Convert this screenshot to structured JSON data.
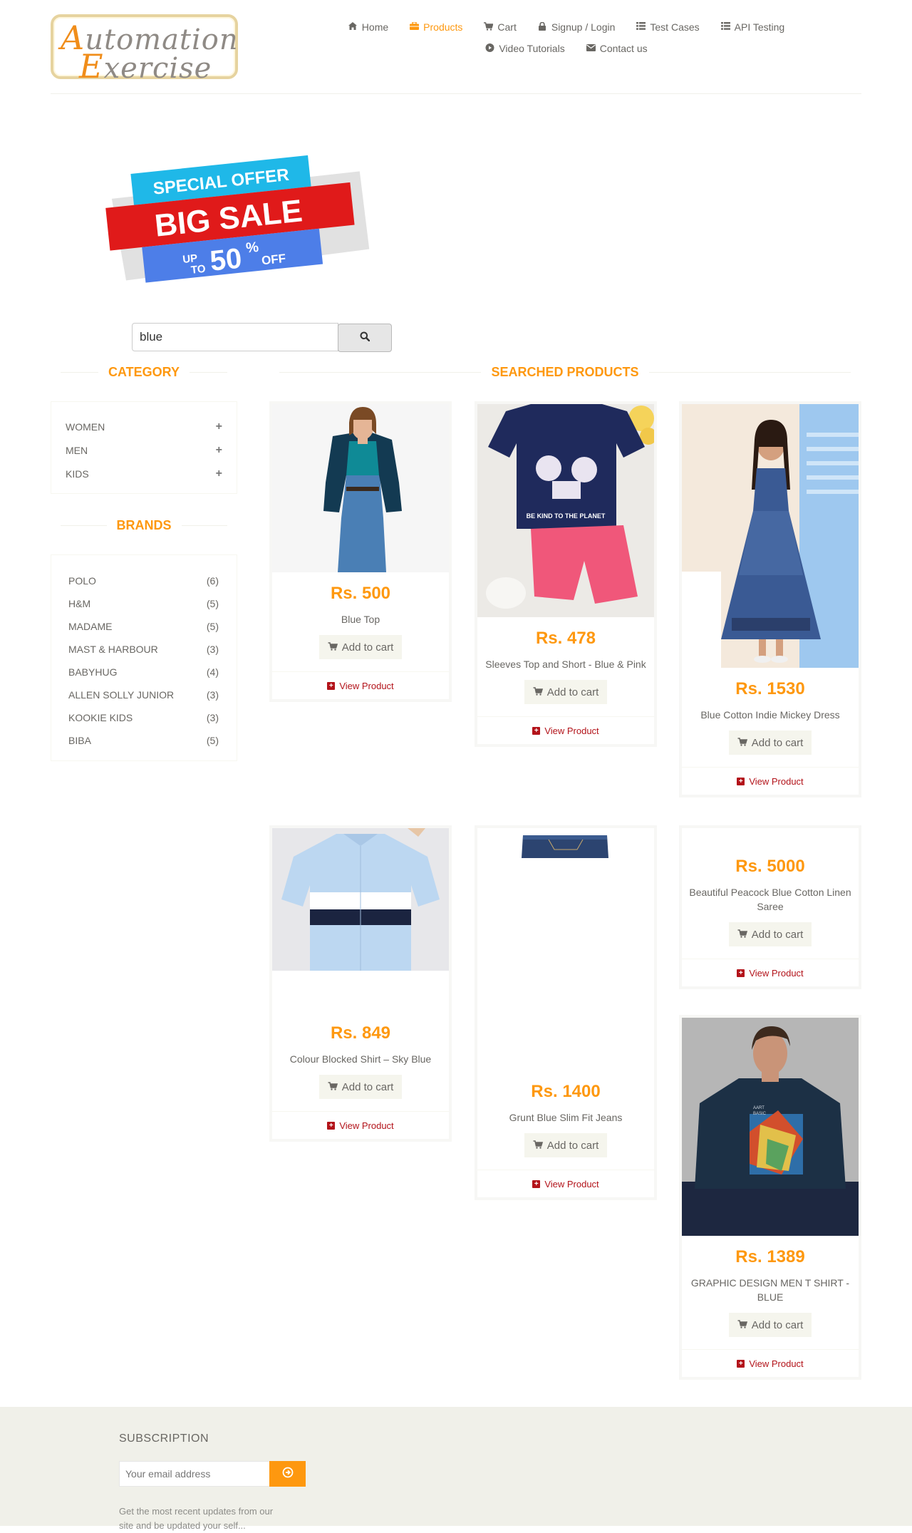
{
  "logo": {
    "line1_cap": "A",
    "line1_rest": "utomation",
    "line2_cap": "E",
    "line2_rest": "xercise"
  },
  "nav": [
    {
      "label": "Home",
      "icon": "home-icon",
      "active": false
    },
    {
      "label": "Products",
      "icon": "briefcase-icon",
      "active": true
    },
    {
      "label": "Cart",
      "icon": "cart-icon",
      "active": false
    },
    {
      "label": "Signup / Login",
      "icon": "lock-icon",
      "active": false
    },
    {
      "label": "Test Cases",
      "icon": "list-icon",
      "active": false
    },
    {
      "label": "API Testing",
      "icon": "list-icon",
      "active": false
    },
    {
      "label": "Video Tutorials",
      "icon": "youtube-play-icon",
      "active": false
    },
    {
      "label": "Contact us",
      "icon": "envelope-icon",
      "active": false
    }
  ],
  "banner": {
    "line1": "SPECIAL OFFER",
    "line2": "BIG SALE",
    "line3a": "UP",
    "line3b": "TO",
    "line3c": "50",
    "line3d": "%",
    "line3e": "OFF"
  },
  "search": {
    "value": "blue"
  },
  "sidebar": {
    "category_title": "CATEGORY",
    "categories": [
      "WOMEN",
      "MEN",
      "KIDS"
    ],
    "brands_title": "BRANDS",
    "brands": [
      {
        "name": "POLO",
        "count": "(6)"
      },
      {
        "name": "H&M",
        "count": "(5)"
      },
      {
        "name": "MADAME",
        "count": "(5)"
      },
      {
        "name": "MAST & HARBOUR",
        "count": "(3)"
      },
      {
        "name": "BABYHUG",
        "count": "(4)"
      },
      {
        "name": "ALLEN SOLLY JUNIOR",
        "count": "(3)"
      },
      {
        "name": "KOOKIE KIDS",
        "count": "(3)"
      },
      {
        "name": "BIBA",
        "count": "(5)"
      }
    ]
  },
  "products_title": "SEARCHED PRODUCTS",
  "add_to_cart_label": "Add to cart",
  "view_product_label": "View Product",
  "products": [
    {
      "price": "Rs. 500",
      "name": "Blue Top"
    },
    {
      "price": "Rs. 478",
      "name": "Sleeves Top and Short - Blue & Pink"
    },
    {
      "price": "Rs. 1530",
      "name": "Blue Cotton Indie Mickey Dress"
    },
    {
      "price": "Rs. 849",
      "name": "Colour Blocked Shirt – Sky Blue"
    },
    {
      "price": "Rs. 1400",
      "name": "Grunt Blue Slim Fit Jeans"
    },
    {
      "price": "Rs. 5000",
      "name": "Beautiful Peacock Blue Cotton Linen Saree"
    },
    {
      "price": "Rs. 1389",
      "name": "GRAPHIC DESIGN MEN T SHIRT - BLUE"
    }
  ],
  "tshirt_print": {
    "line1": "AART",
    "line2": "BASIC"
  },
  "kids_top_print": {
    "line1": "BE KIND TO THE PLANET"
  },
  "footer": {
    "subscription_title": "SUBSCRIPTION",
    "email_placeholder": "Your email address",
    "text": "Get the most recent updates from our site and be updated your self..."
  }
}
